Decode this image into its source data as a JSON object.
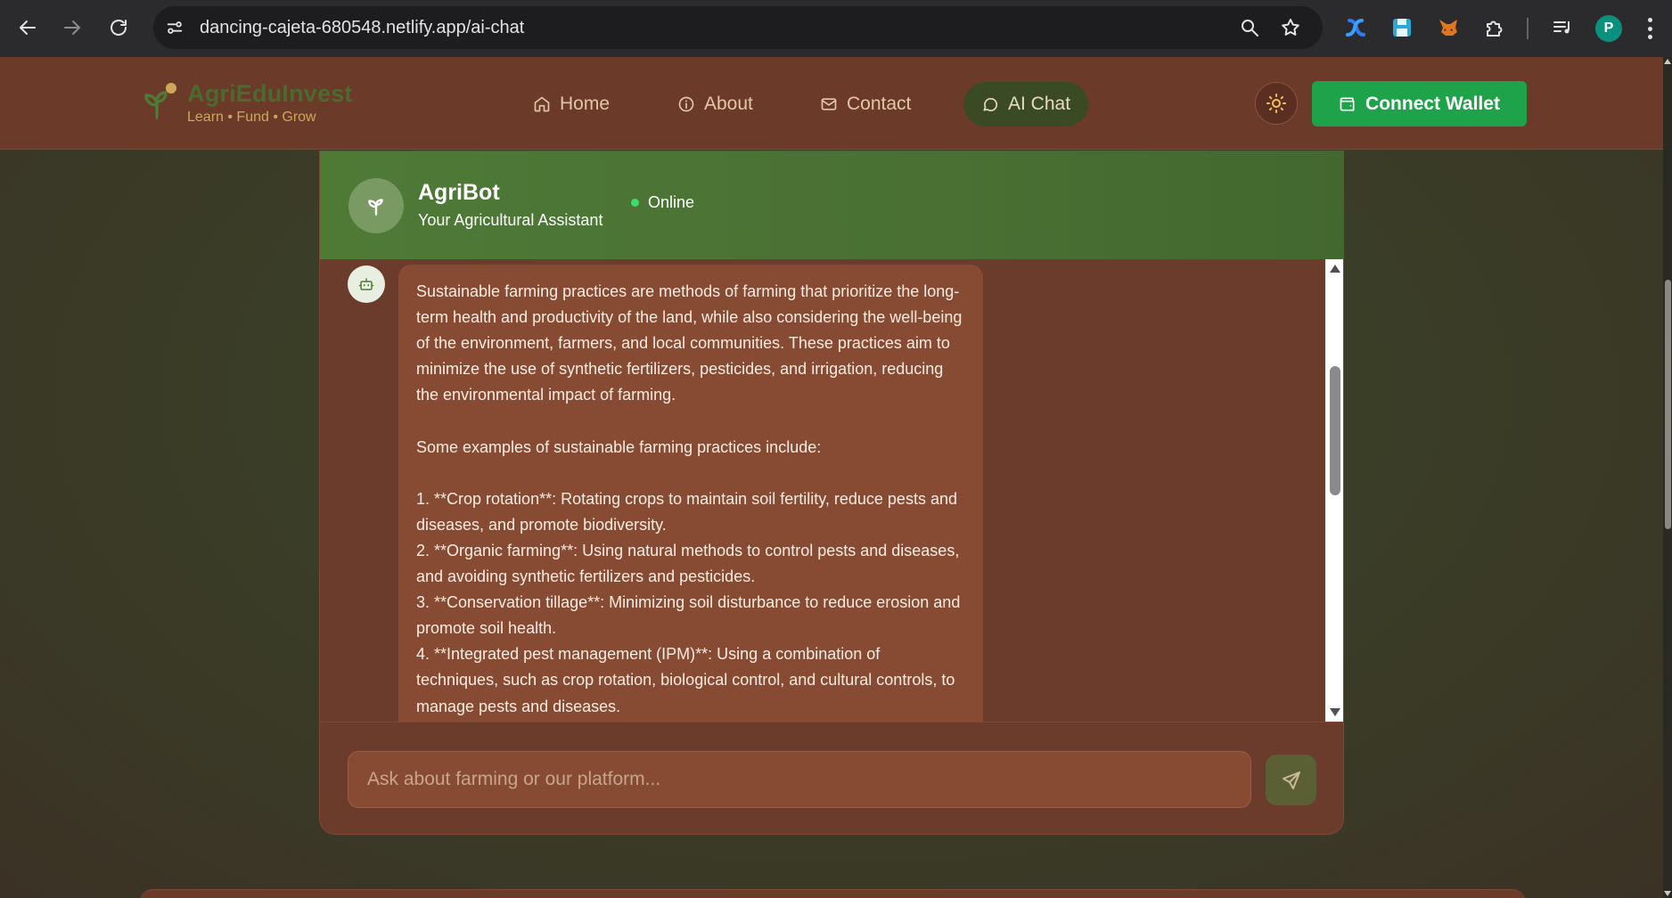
{
  "browser": {
    "url": "dancing-cajeta-680548.netlify.app/ai-chat",
    "profile_initial": "P"
  },
  "header": {
    "brand": "AgriEduInvest",
    "tagline": "Learn • Fund • Grow",
    "nav": [
      {
        "label": "Home",
        "icon": "home-icon"
      },
      {
        "label": "About",
        "icon": "info-icon"
      },
      {
        "label": "Contact",
        "icon": "mail-icon"
      },
      {
        "label": "AI Chat",
        "icon": "chat-icon",
        "active": true
      }
    ],
    "wallet_button": "Connect Wallet"
  },
  "chat": {
    "bot_name": "AgriBot",
    "bot_subtitle": "Your Agricultural Assistant",
    "status": "Online",
    "message": "Sustainable farming practices are methods of farming that prioritize the long-term health and productivity of the land, while also considering the well-being of the environment, farmers, and local communities. These practices aim to minimize the use of synthetic fertilizers, pesticides, and irrigation, reducing the environmental impact of farming.\n\nSome examples of sustainable farming practices include:\n\n1. **Crop rotation**: Rotating crops to maintain soil fertility, reduce pests and diseases, and promote biodiversity.\n2. **Organic farming**: Using natural methods to control pests and diseases, and avoiding synthetic fertilizers and pesticides.\n3. **Conservation tillage**: Minimizing soil disturbance to reduce erosion and promote soil health.\n4. **Integrated pest management (IPM)**: Using a combination of techniques, such as crop rotation, biological control, and cultural controls, to manage pests and diseases.",
    "input_placeholder": "Ask about farming or our platform..."
  },
  "colors": {
    "header_bg": "#6b3a29",
    "chat_header_green": "#4e7a36",
    "wallet_green": "#1ea34a",
    "bubble_bg": "#874b33",
    "online_dot": "#3ddc6e"
  }
}
